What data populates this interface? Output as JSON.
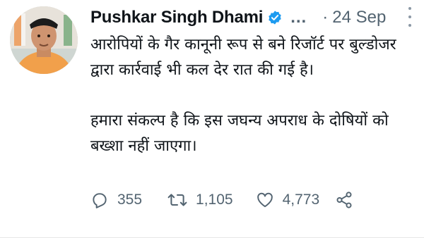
{
  "tweet": {
    "author_name": "Pushkar Singh Dhami",
    "handle_truncated": "…",
    "separator": "·",
    "date": "24 Sep",
    "paragraphs": [
      "आरोपियों के गैर कानूनी रूप से बने रिजॉर्ट पर बुल्डोजर द्वारा कार्रवाई भी कल देर रात की गई है।",
      "हमारा संकल्प है कि इस जघन्य अपराध के दोषियों को बख्शा नहीं जाएगा।"
    ],
    "replies": "355",
    "retweets": "1,105",
    "likes": "4,773"
  },
  "icons": {
    "verified": "verified-badge-icon",
    "more": "more-options-icon",
    "reply": "reply-icon",
    "retweet": "retweet-icon",
    "like": "heart-icon",
    "share": "share-icon"
  },
  "colors": {
    "text": "#0f1419",
    "muted": "#536471",
    "verified": "#1d9bf0"
  }
}
